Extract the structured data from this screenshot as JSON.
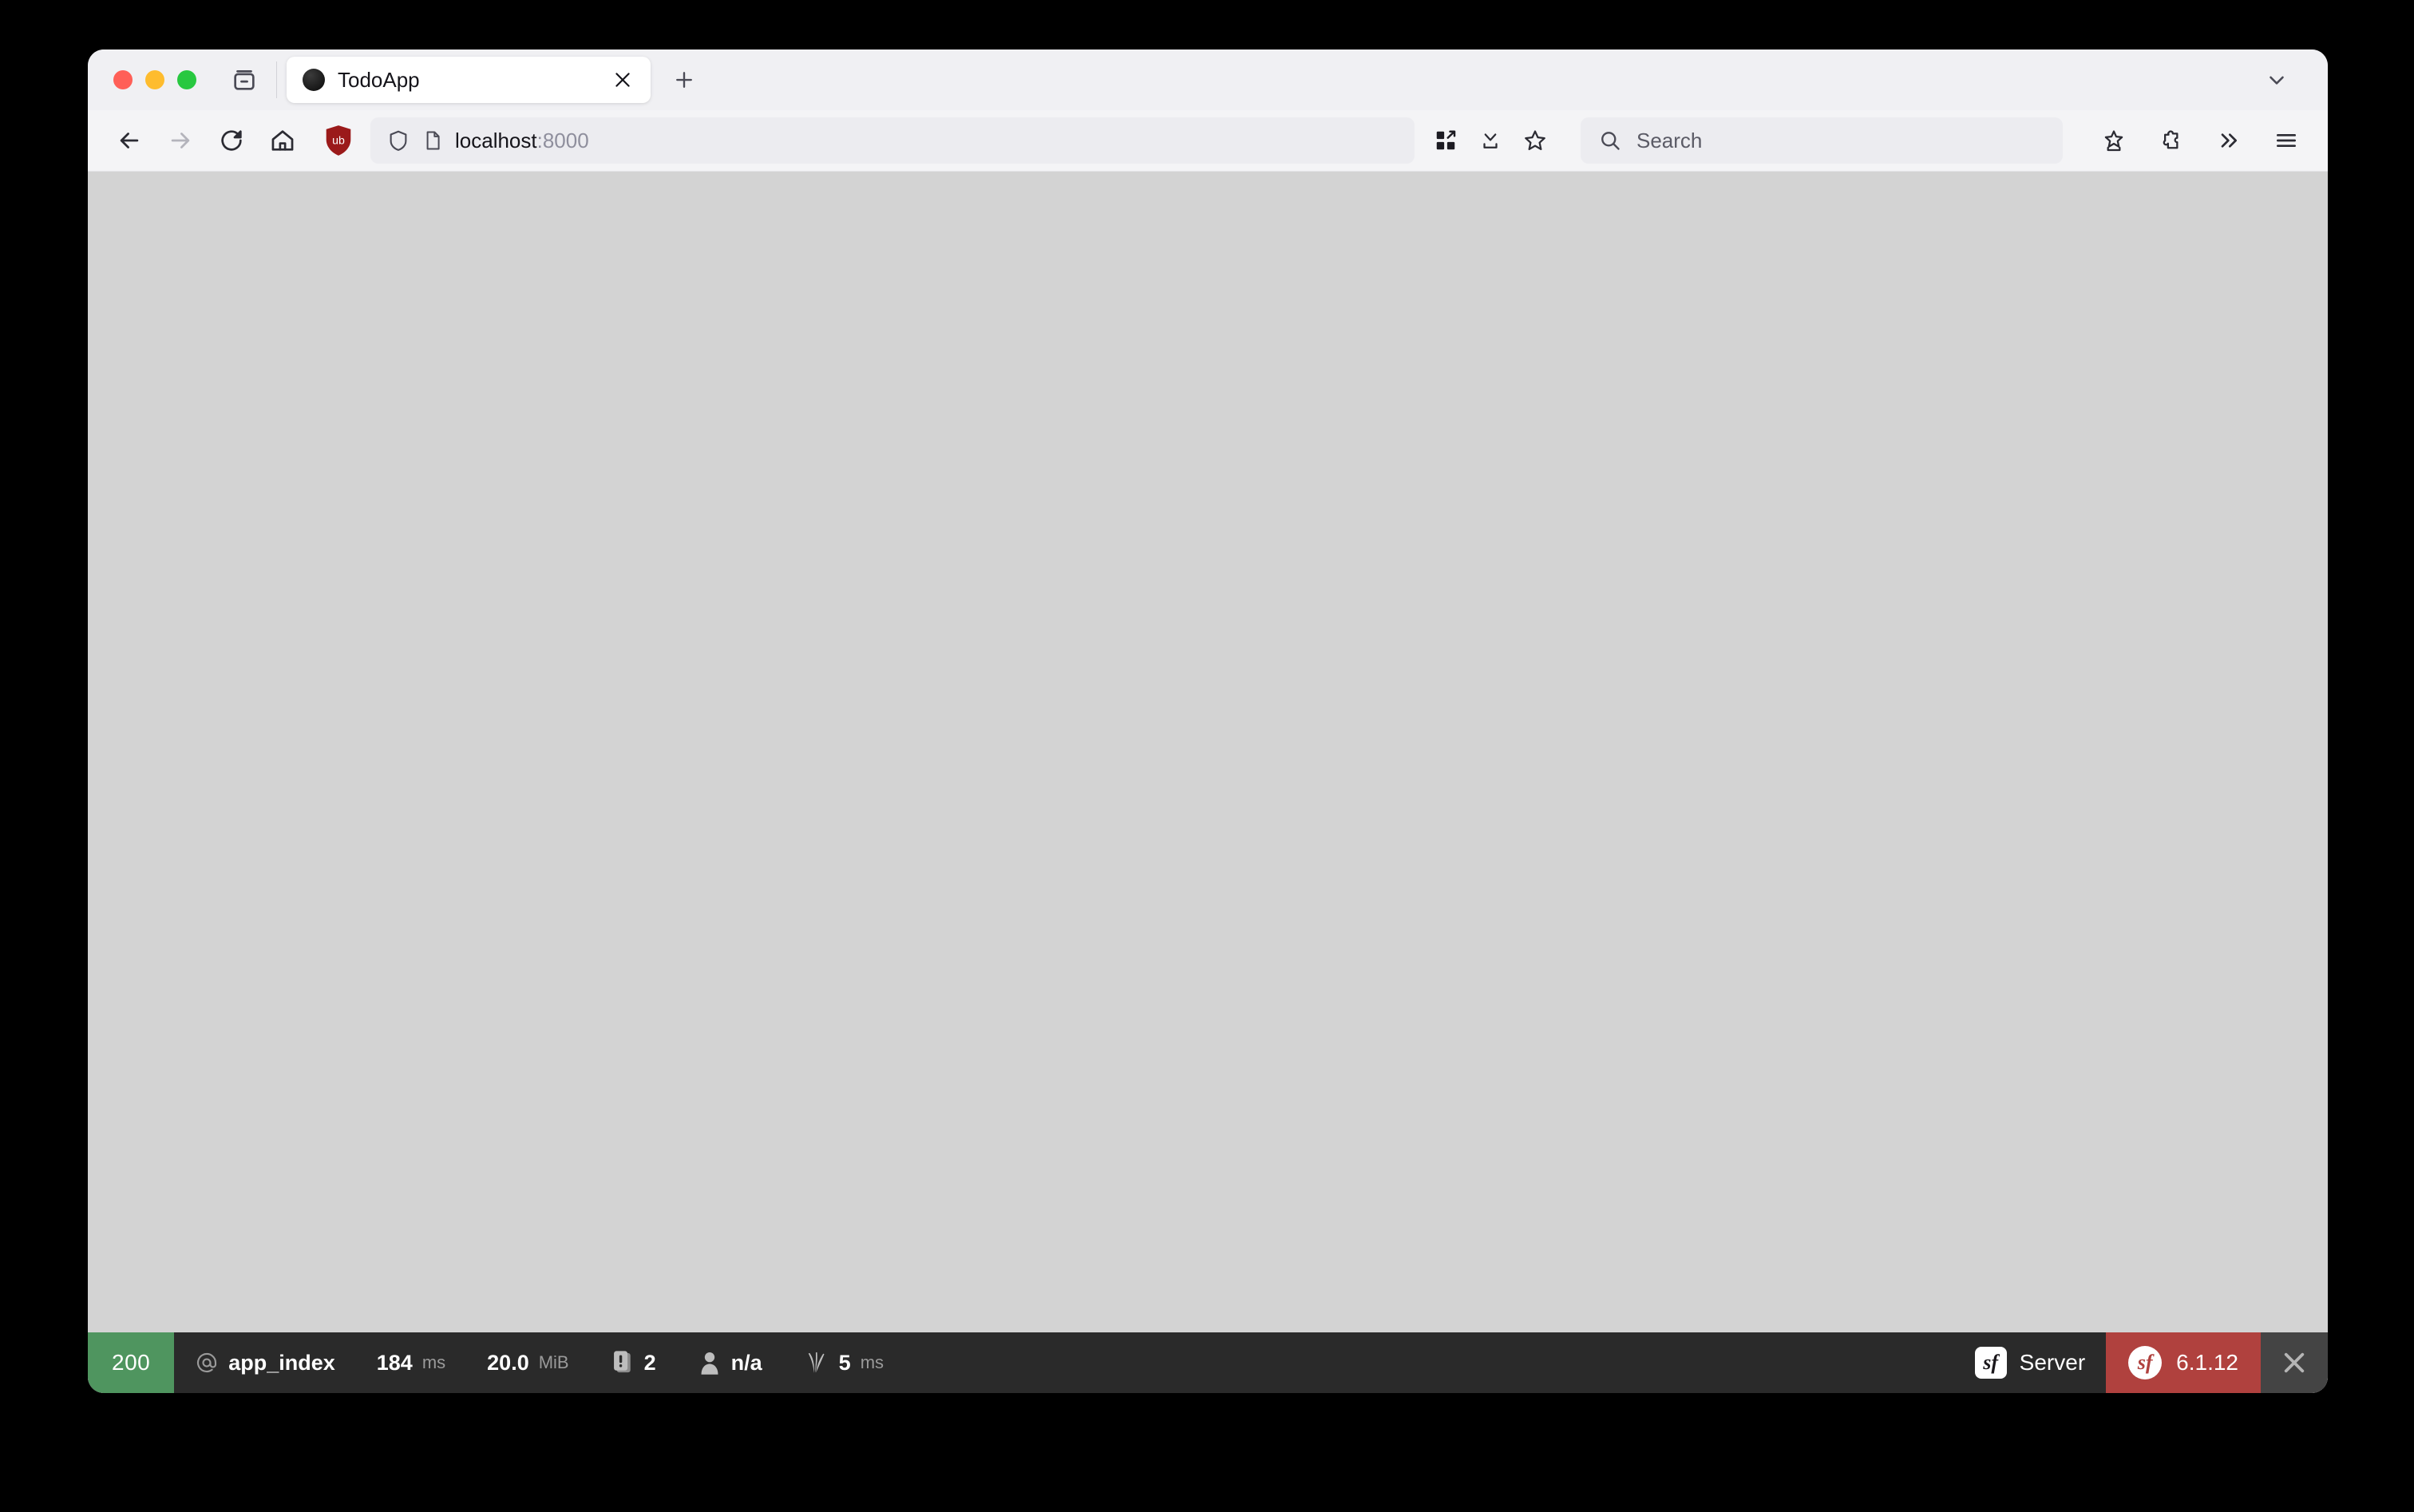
{
  "window": {
    "traffic_lights": [
      {
        "name": "close",
        "color": "#ff5f57"
      },
      {
        "name": "minimize",
        "color": "#febc2e"
      },
      {
        "name": "zoom",
        "color": "#28c840"
      }
    ]
  },
  "tabstrip": {
    "firefox_view_icon": "firefox-view-icon",
    "tabs": [
      {
        "title": "TodoApp",
        "favicon": "dark-circle-favicon",
        "close_icon": "close-icon",
        "active": true
      }
    ],
    "new_tab_icon": "plus-icon",
    "tab_list_icon": "chevron-down-icon"
  },
  "navbar": {
    "back_icon": "arrow-left-icon",
    "forward_icon": "arrow-right-icon",
    "reload_icon": "reload-icon",
    "home_icon": "home-icon",
    "ublock": {
      "icon": "ublock-shield-icon",
      "label": "ub",
      "color": "#9b1a1a"
    },
    "url": {
      "shield_icon": "tracking-protection-shield-icon",
      "page_icon": "page-document-icon",
      "host": "localhost",
      "port": ":8000",
      "full": "localhost:8000"
    },
    "url_actions": [
      {
        "name": "split-view-icon"
      },
      {
        "name": "downloads-icon"
      },
      {
        "name": "bookmark-star-icon"
      }
    ],
    "search": {
      "icon": "search-icon",
      "placeholder": "Search",
      "value": ""
    },
    "right_actions": [
      {
        "name": "save-to-pocket-icon"
      },
      {
        "name": "extensions-puzzle-icon"
      },
      {
        "name": "overflow-chevrons-icon"
      },
      {
        "name": "app-menu-hamburger-icon"
      }
    ]
  },
  "content": {
    "background_color": "#d3d3d3",
    "body_text": ""
  },
  "symfony_toolbar": {
    "status_code": "200",
    "status_color": "#4f955f",
    "route": {
      "icon": "at-sign-icon",
      "prefix": "@",
      "name": "app_index"
    },
    "duration": {
      "value": "184",
      "unit": "ms"
    },
    "memory": {
      "value": "20.0",
      "unit": "MiB"
    },
    "exceptions": {
      "icon": "exception-log-icon",
      "count": "2"
    },
    "user": {
      "icon": "user-silhouette-icon",
      "value": "n/a"
    },
    "twig": {
      "icon": "twig-leaf-icon",
      "value": "5",
      "unit": "ms"
    },
    "server": {
      "icon": "symfony-logo-icon",
      "label": "Server"
    },
    "version": {
      "icon": "symfony-circle-logo-icon",
      "label": "6.1.12",
      "color": "#b0413e"
    },
    "close": {
      "icon": "close-icon"
    }
  }
}
